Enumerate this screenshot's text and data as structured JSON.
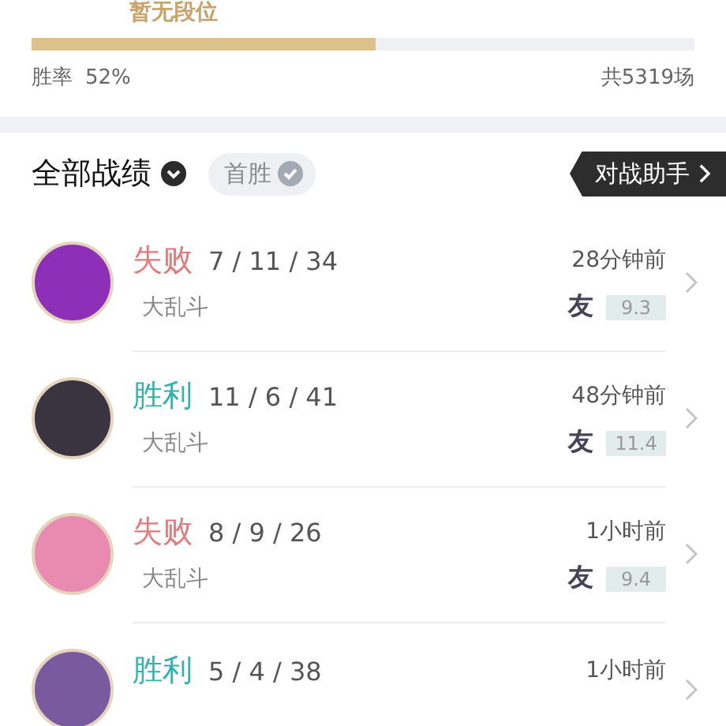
{
  "rank": {
    "label": "暂无段位"
  },
  "win_rate": {
    "label": "胜率",
    "value": "52%",
    "level": 0.52,
    "total": "共5319场"
  },
  "header": {
    "title": "全部战绩",
    "filter": "首胜",
    "assistant_button": "对战助手"
  },
  "matches": [
    {
      "result": "失败",
      "kind": "loss",
      "kda": "7 / 11 / 34",
      "mode": "大乱斗",
      "time": "28分钟前",
      "friend": "友",
      "score": "9.3",
      "color": "#8e2fb8"
    },
    {
      "result": "胜利",
      "kind": "win",
      "kda": "11 / 6 / 41",
      "mode": "大乱斗",
      "time": "48分钟前",
      "friend": "友",
      "score": "11.4",
      "color": "#3a3340"
    },
    {
      "result": "失败",
      "kind": "loss",
      "kda": "8 / 9 / 26",
      "mode": "大乱斗",
      "time": "1小时前",
      "friend": "友",
      "score": "9.4",
      "color": "#e98bb0"
    },
    {
      "result": "胜利",
      "kind": "win",
      "kda": "5 / 4 / 38",
      "time": "1小时前",
      "color": "#7a5a9e"
    }
  ]
}
